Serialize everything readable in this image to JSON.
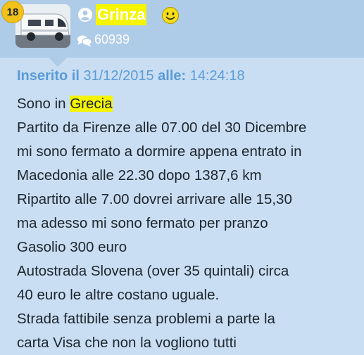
{
  "author": {
    "rank": "18",
    "username": "Grinza",
    "post_count": "60939",
    "user_icon": "user-circle-icon",
    "mood_icon": "smiley-icon",
    "posts_icon": "chat-bubbles-icon"
  },
  "post": {
    "inserted_label": "Inserito il",
    "date": "31/12/2015",
    "time_label": "alle:",
    "time": "14:24:18",
    "lines": [
      {
        "before": "Sono in ",
        "highlight": "Grecia"
      },
      {
        "text": "Partito da Firenze alle 07.00 del 30 Dicembre"
      },
      {
        "text": "mi sono fermato a dormire appena entrato in"
      },
      {
        "text": "Macedonia alle 22.30 dopo 1387,6 km"
      },
      {
        "text": "Ripartito alle 7.00 dovrei arrivare alle 15,30"
      },
      {
        "text": "ma adesso mi sono fermato per pranzo"
      },
      {
        "text": "Gasolio 300 euro"
      },
      {
        "text": "Autostrada Slovena (over 35 quintali) circa"
      },
      {
        "text": "40 euro le altre costano uguale."
      },
      {
        "text": "Strada fattibile senza problemi a parte la"
      },
      {
        "text": "carta Visa che non la vogliono tutti"
      }
    ]
  },
  "colors": {
    "header_bg": "#aecbe8",
    "body_bg": "#c9def2",
    "highlight": "#f5f500",
    "meta_text": "#5b9bd8",
    "rank_badge": "#f2c21b"
  }
}
